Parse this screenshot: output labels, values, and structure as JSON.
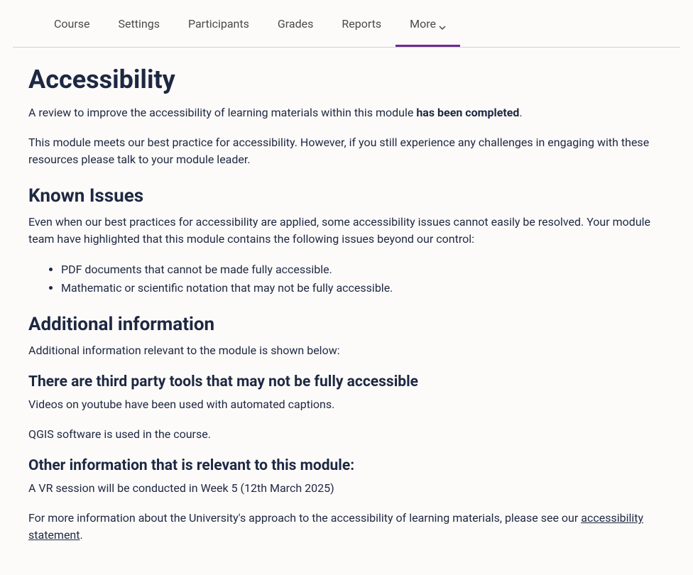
{
  "tabs": {
    "course": "Course",
    "settings": "Settings",
    "participants": "Participants",
    "grades": "Grades",
    "reports": "Reports",
    "more": "More"
  },
  "page": {
    "title": "Accessibility",
    "intro_prefix": "A review to improve the accessibility of learning materials within this module ",
    "intro_bold": "has been completed",
    "intro_suffix": ".",
    "best_practice": "This module meets our best practice for accessibility. However, if you still experience any challenges in engaging with these resources please talk to your module leader.",
    "known_issues_heading": "Known Issues",
    "known_issues_text": "Even when our best practices for accessibility are applied, some accessibility issues cannot easily be resolved. Your module team have highlighted that this module contains the following issues beyond our control:",
    "issues": [
      "PDF documents that cannot be made fully accessible.",
      "Mathematic or scientific notation that may not be fully accessible."
    ],
    "additional_heading": "Additional information",
    "additional_text": "Additional information relevant to the module is shown below:",
    "third_party_heading": "There are third party tools that may not be fully accessible",
    "third_party_videos": "Videos on youtube have been used with automated captions.",
    "third_party_qgis": "QGIS software is used in the course.",
    "other_info_heading": "Other information that is relevant to this module:",
    "other_info_text": "A VR session will be conducted in Week 5 (12th March 2025)",
    "more_info_prefix": "For more information about the University's approach to the accessibility of learning materials, please see our ",
    "accessibility_link": "accessibility statement",
    "more_info_suffix": "."
  }
}
